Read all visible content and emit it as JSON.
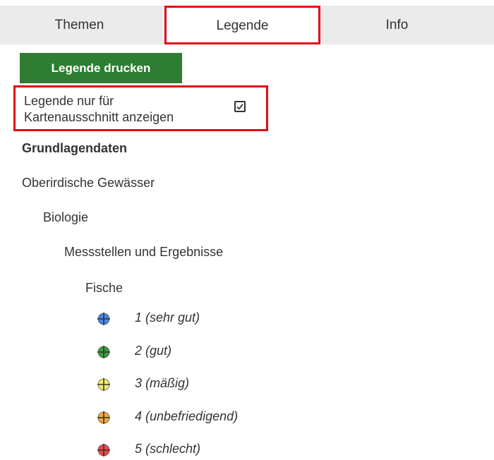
{
  "tabs": [
    {
      "label": "Themen",
      "active": false
    },
    {
      "label": "Legende",
      "active": true
    },
    {
      "label": "Info",
      "active": false
    }
  ],
  "print_button": {
    "label": "Legende drucken",
    "color": "#2e7d32"
  },
  "extent_option": {
    "label_line1": "Legende nur für",
    "label_line2": "Kartenausschnitt anzeigen",
    "checked": true
  },
  "tree": {
    "group": "Grundlagendaten",
    "theme": "Oberirdische Gewässer",
    "subtheme": "Biologie",
    "layer": "Messstellen und Ergebnisse",
    "sublayer": "Fische"
  },
  "legend_items": [
    {
      "label": "1 (sehr gut)",
      "icon": "crosshair-circle-icon",
      "color": "#4a86e8"
    },
    {
      "label": "2 (gut)",
      "icon": "crosshair-circle-icon",
      "color": "#3c9a3c"
    },
    {
      "label": "3 (mäßig)",
      "icon": "crosshair-circle-icon",
      "color": "#f2ee6a"
    },
    {
      "label": "4 (unbefriedigend)",
      "icon": "crosshair-circle-icon",
      "color": "#f2a93b"
    },
    {
      "label": "5 (schlecht)",
      "icon": "crosshair-circle-icon",
      "color": "#e84a4a"
    }
  ],
  "highlight_color": "#e30613"
}
